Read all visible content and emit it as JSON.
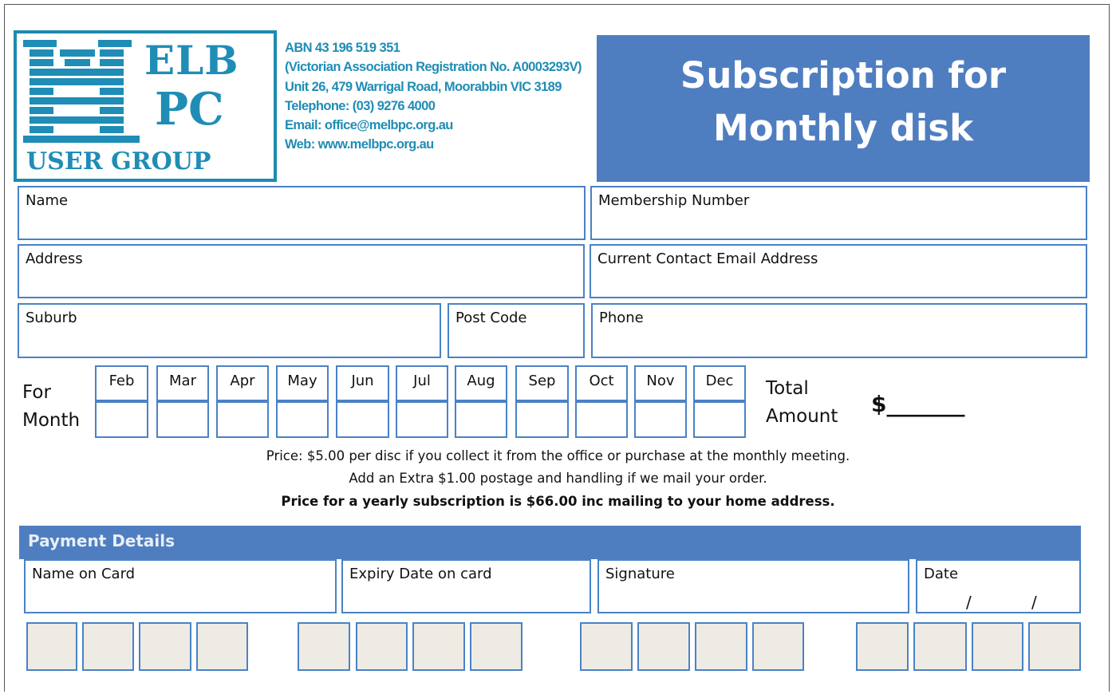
{
  "org": {
    "logo": {
      "line1": "ELB",
      "line2": "PC",
      "line3": "USER GROUP",
      "monogram": "M"
    },
    "info": [
      "ABN 43 196 519 351",
      "(Victorian Association Registration No.  A0003293V)",
      "Unit 26, 479 Warrigal Road, Moorabbin VIC 3189",
      "Telephone: (03) 9276 4000",
      "Email: office@melbpc.org.au",
      "Web: www.melbpc.org.au"
    ],
    "brand_color": "#1f8db5"
  },
  "title": {
    "line1": "Subscription for",
    "line2": "Monthly disk",
    "bg_color": "#4f7ec0"
  },
  "fields": {
    "name": "Name",
    "membership_number": "Membership Number",
    "address": "Address",
    "email": "Current Contact Email Address",
    "suburb": "Suburb",
    "post_code": "Post Code",
    "phone": "Phone"
  },
  "months": {
    "label_line1": "For",
    "label_line2": "Month",
    "items": [
      "Feb",
      "Mar",
      "Apr",
      "May",
      "Jun",
      "Jul",
      "Aug",
      "Sep",
      "Oct",
      "Nov",
      "Dec"
    ]
  },
  "total": {
    "label_line1": "Total",
    "label_line2": "Amount",
    "value": "$_______"
  },
  "price": {
    "line1": "Price:  $5.00 per disc if you collect it from the office or purchase at the monthly meeting.",
    "line2": "Add an Extra $1.00 postage and handling if we mail your order.",
    "line3": "Price for a yearly subscription is $66.00 inc mailing to your home address."
  },
  "payment": {
    "header": "Payment Details",
    "name_on_card": "Name on Card",
    "expiry": "Expiry Date on card",
    "signature": "Signature",
    "date": "Date",
    "date_sep": "/",
    "card_groups": 4,
    "digits_per_group": 4
  }
}
